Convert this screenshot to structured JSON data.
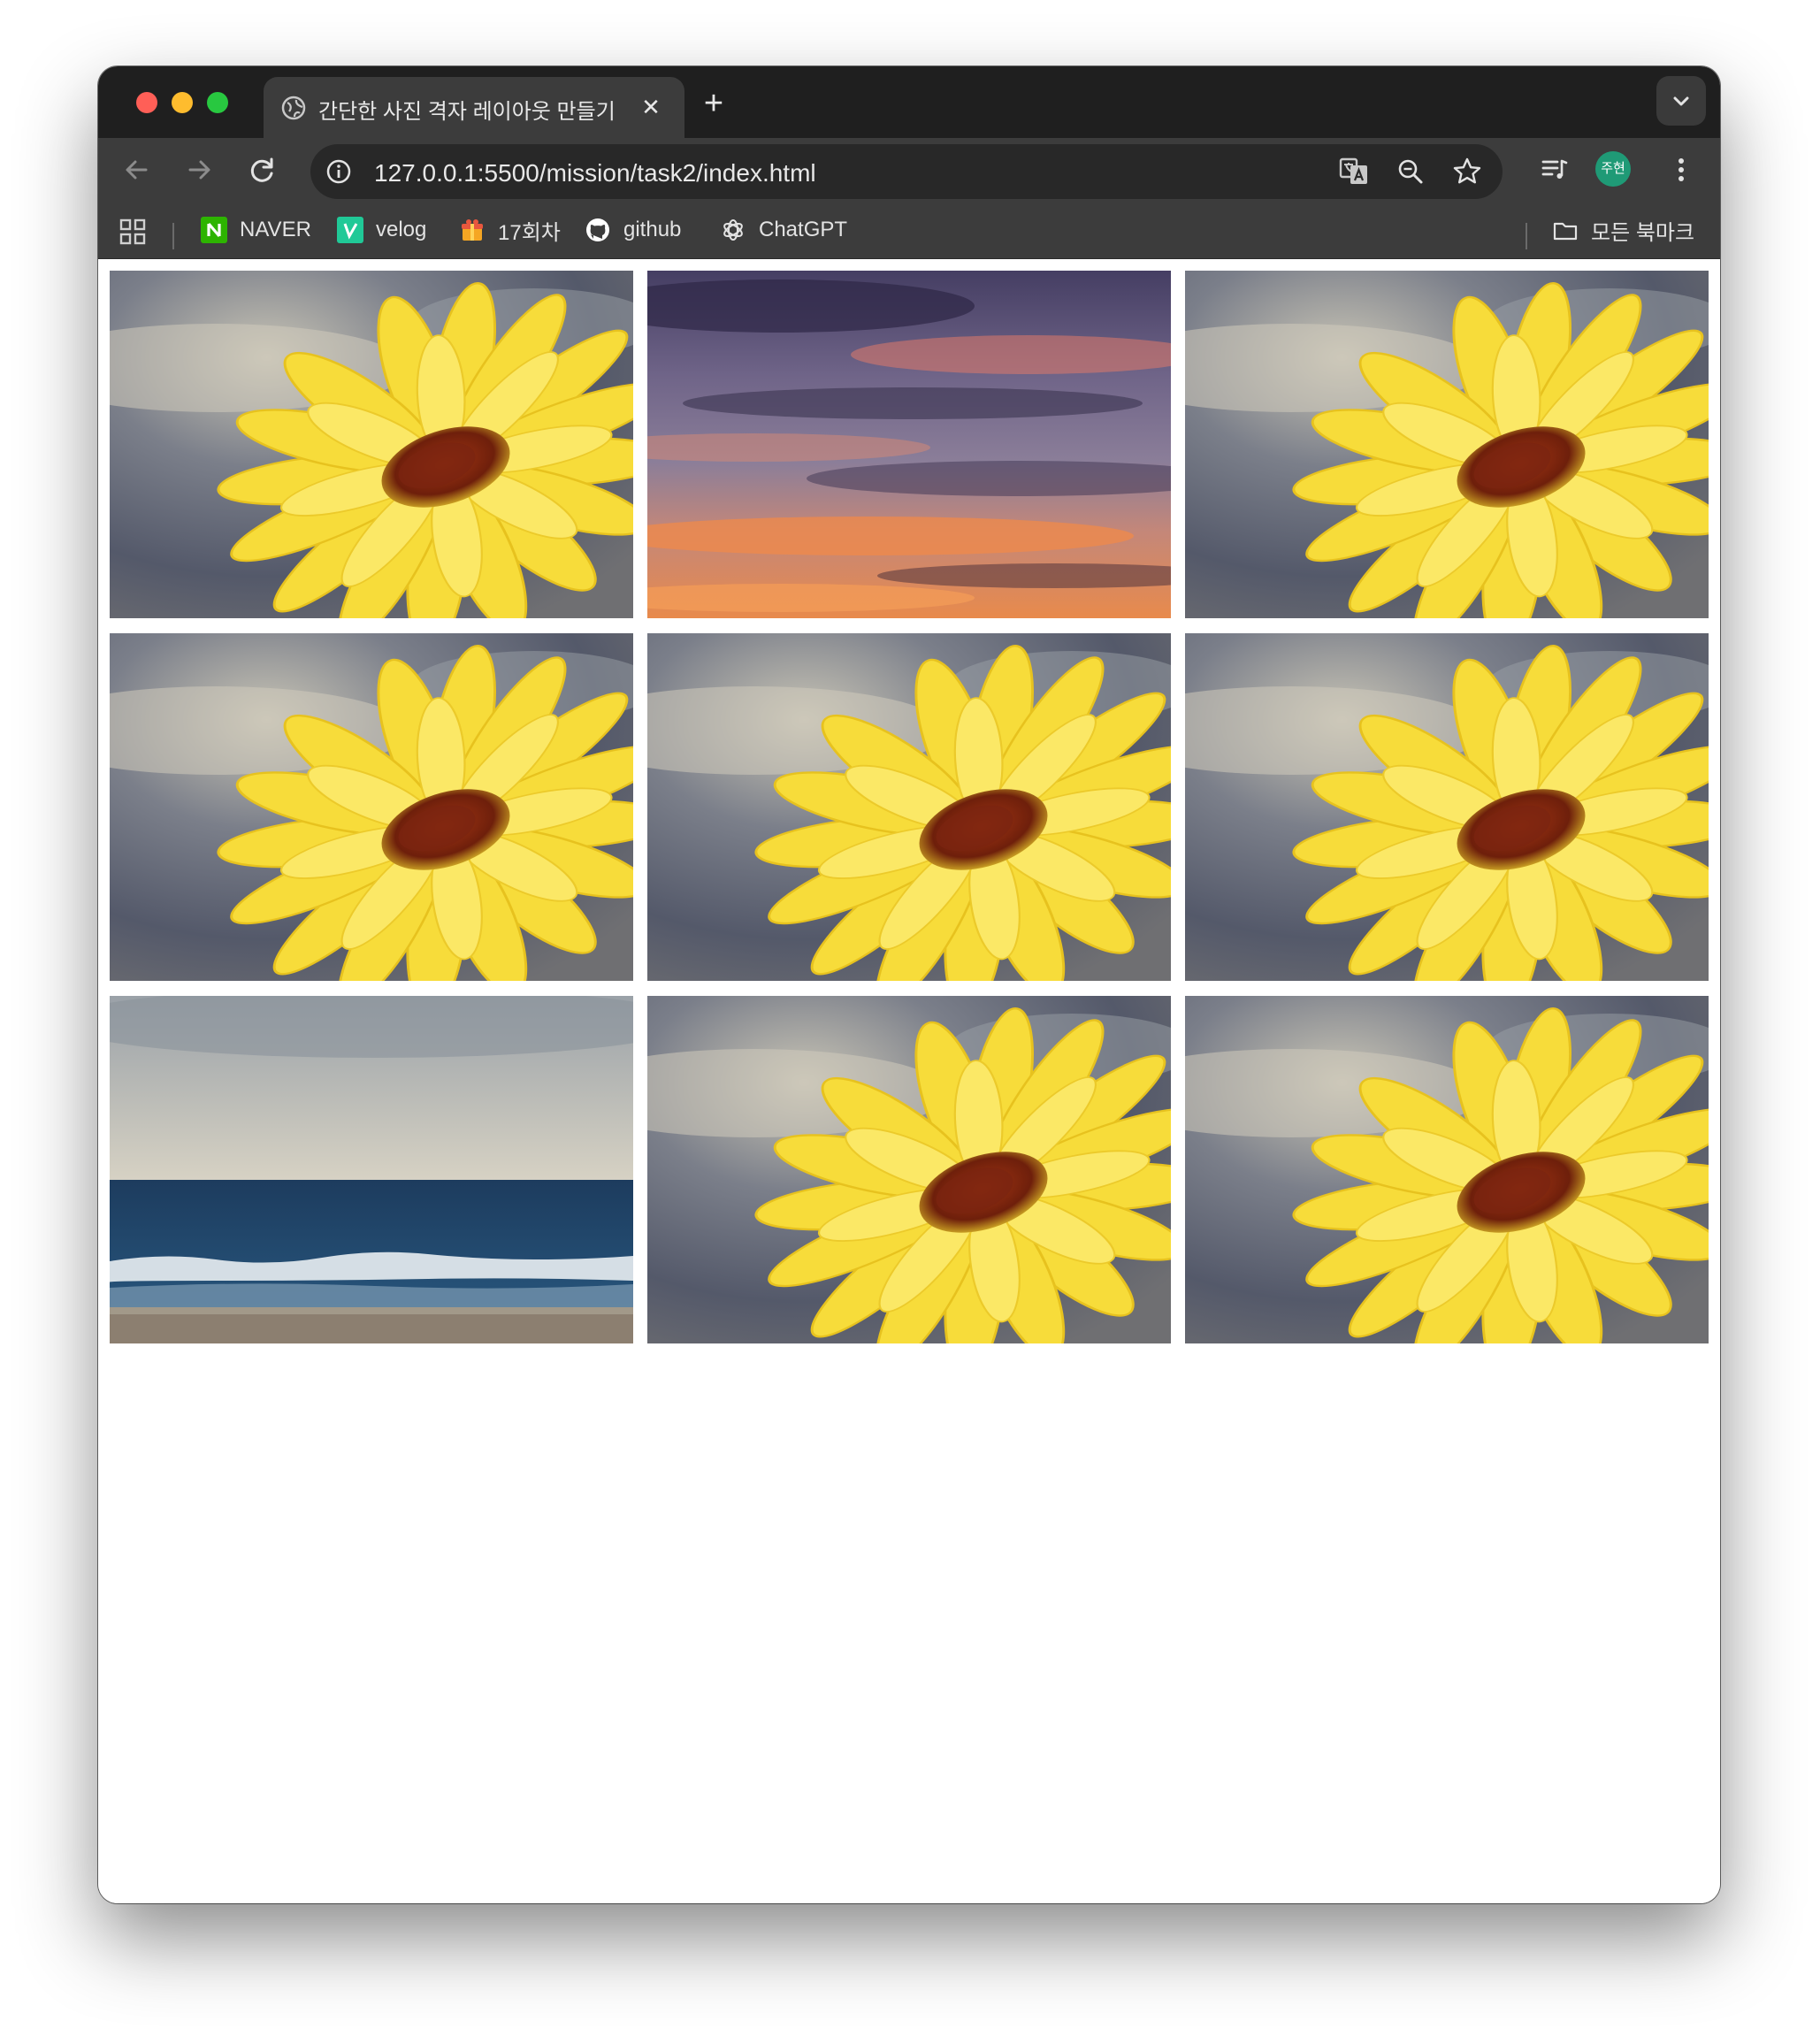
{
  "tab": {
    "title": "간단한 사진 격자 레이아웃 만들기",
    "close_glyph": "✕",
    "new_tab_glyph": "+"
  },
  "toolbar": {
    "url": "127.0.0.1:5500/mission/task2/index.html",
    "profile_label": "주현"
  },
  "bookmarks": {
    "items": [
      {
        "label": "NAVER",
        "icon": "naver-icon"
      },
      {
        "label": "velog",
        "icon": "velog-icon"
      },
      {
        "label": "17회차",
        "icon": "gift-icon"
      },
      {
        "label": "github",
        "icon": "github-icon"
      },
      {
        "label": "ChatGPT",
        "icon": "chatgpt-icon"
      }
    ],
    "all_bookmarks_label": "모든 북마크"
  },
  "gallery": {
    "photos": [
      "flower",
      "sunset-sky",
      "flower",
      "flower",
      "flower",
      "flower",
      "ocean-beach",
      "flower",
      "flower"
    ]
  },
  "colors": {
    "tabstrip": "#1f1f1f",
    "toolbar": "#3c3c3c",
    "omnibox": "#282828",
    "avatar": "#1f9a76",
    "flower": "#f7dc3a",
    "flower_center": "#7a2410"
  }
}
